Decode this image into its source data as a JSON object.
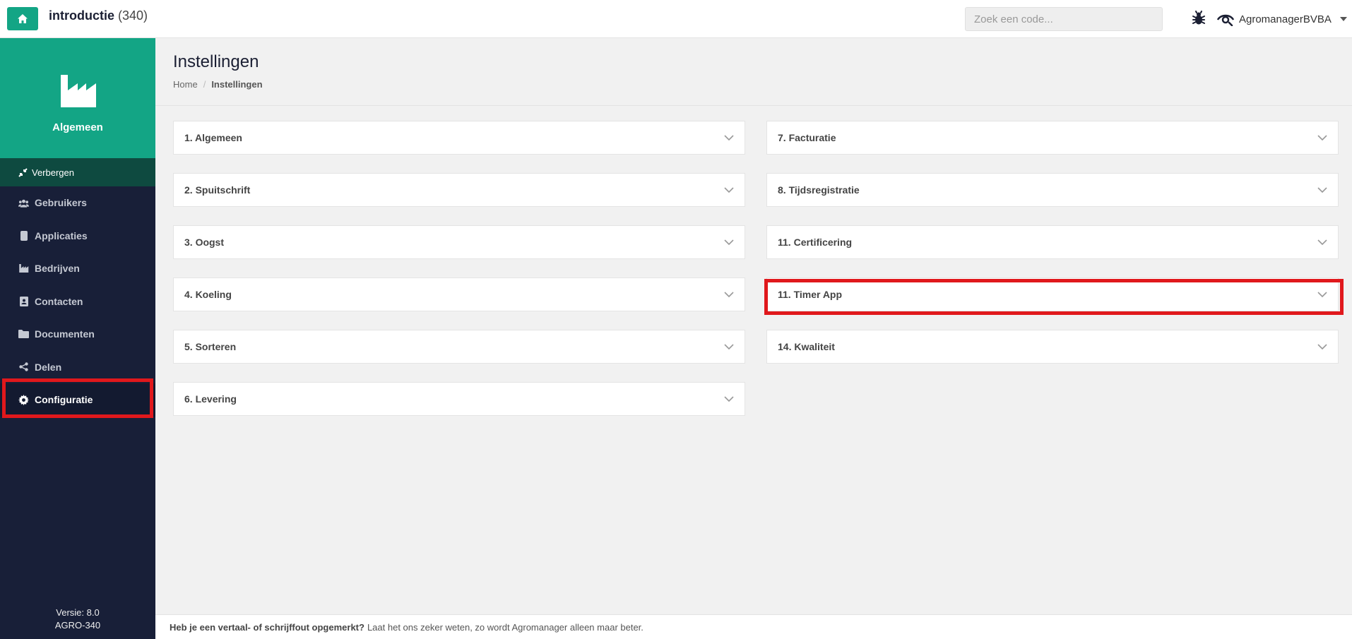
{
  "header": {
    "app_name": "introductie",
    "app_count": "(340)",
    "search_placeholder": "Zoek een code...",
    "user": "AgromanagerBVBA"
  },
  "sidebar": {
    "title": "Algemeen",
    "hide_label": "Verbergen",
    "items": [
      {
        "label": "Gebruikers",
        "icon": "users-icon"
      },
      {
        "label": "Applicaties",
        "icon": "mobile-icon"
      },
      {
        "label": "Bedrijven",
        "icon": "factory-icon"
      },
      {
        "label": "Contacten",
        "icon": "address-book-icon"
      },
      {
        "label": "Documenten",
        "icon": "folder-icon"
      },
      {
        "label": "Delen",
        "icon": "share-icon"
      },
      {
        "label": "Configuratie",
        "icon": "gear-icon",
        "active": true
      }
    ],
    "version": "Versie: 8.0",
    "build": "AGRO-340"
  },
  "page": {
    "title": "Instellingen",
    "breadcrumb": [
      "Home",
      "Instellingen"
    ]
  },
  "panels_left": [
    "1. Algemeen",
    "2. Spuitschrift",
    "3. Oogst",
    "4. Koeling",
    "5. Sorteren",
    "6. Levering"
  ],
  "panels_right": [
    "7. Facturatie",
    "8. Tijdsregistratie",
    "11. Certificering",
    "11. Timer App",
    "14. Kwaliteit"
  ],
  "footer": {
    "bold": "Heb je een vertaal- of schrijffout opgemerkt?",
    "text": "Laat het ons zeker weten, zo wordt Agromanager alleen maar beter."
  },
  "colors": {
    "accent": "#13a585",
    "sidebar": "#181f38",
    "highlight": "#e0181c"
  }
}
